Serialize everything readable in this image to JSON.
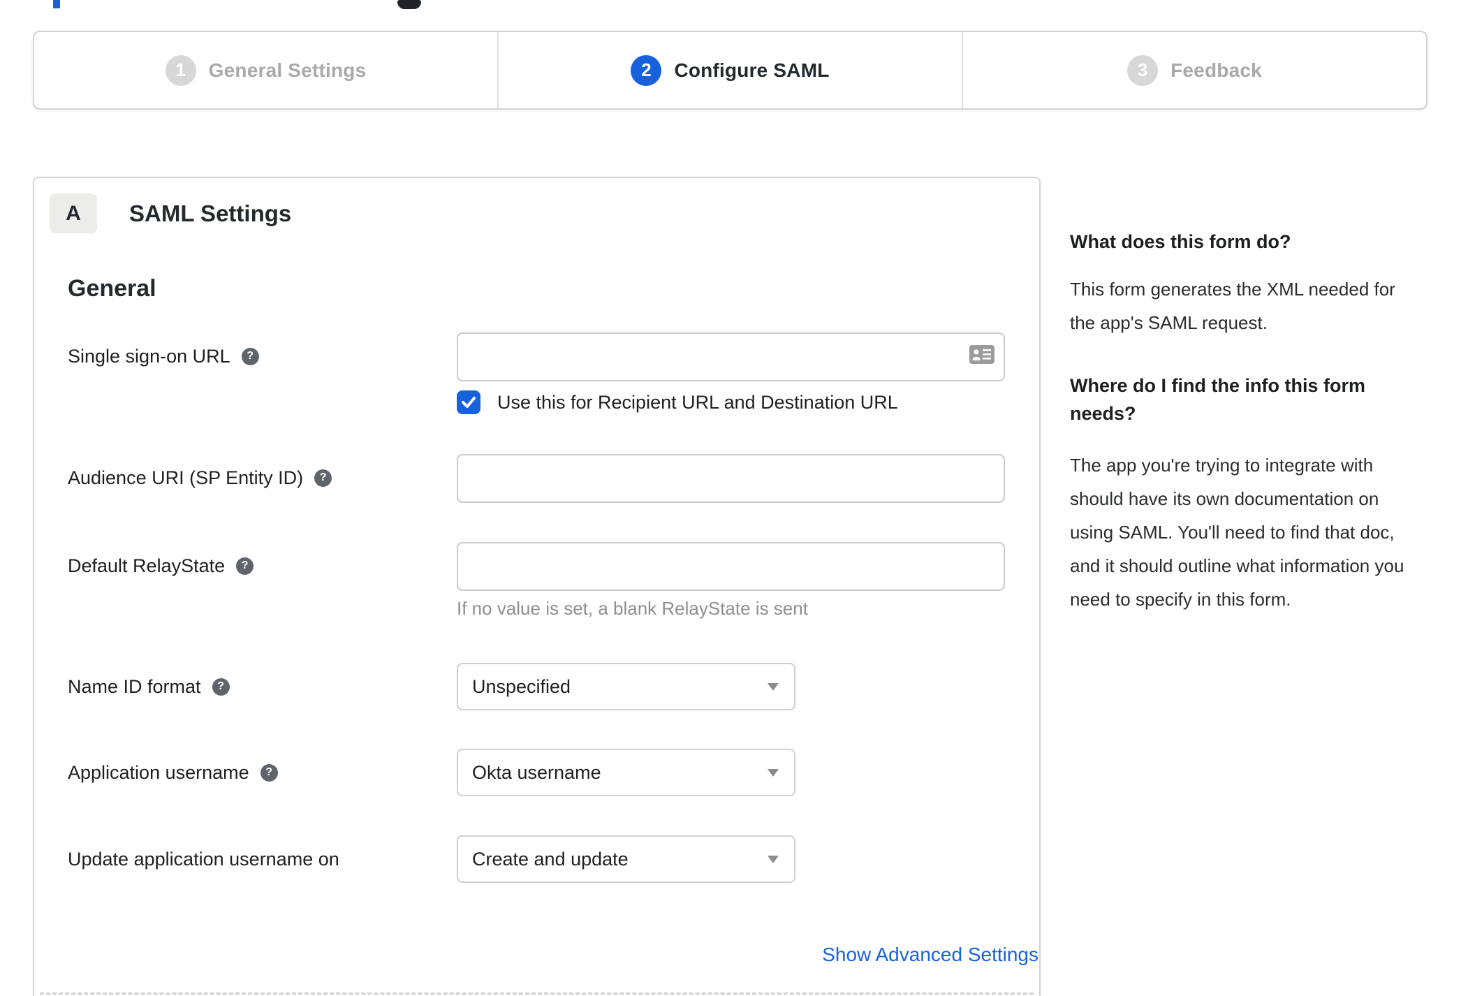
{
  "stepper": {
    "active_step": "2",
    "steps": [
      {
        "number": "1",
        "label": "General Settings"
      },
      {
        "number": "2",
        "label": "Configure SAML"
      },
      {
        "number": "3",
        "label": "Feedback"
      }
    ]
  },
  "panel": {
    "badge": "A",
    "title": "SAML Settings",
    "section": "General",
    "fields": {
      "sso_url": {
        "label": "Single sign-on URL",
        "value": "",
        "checkbox_checked": true,
        "checkbox_label": "Use this for Recipient URL and Destination URL"
      },
      "audience_uri": {
        "label": "Audience URI (SP Entity ID)",
        "value": ""
      },
      "relay_state": {
        "label": "Default RelayState",
        "value": "",
        "hint": "If no value is set, a blank RelayState is sent"
      },
      "name_id": {
        "label": "Name ID format",
        "value": "Unspecified"
      },
      "app_username": {
        "label": "Application username",
        "value": "Okta username"
      },
      "update_username": {
        "label": "Update application username on",
        "value": "Create and update"
      }
    },
    "advanced_link": "Show Advanced Settings"
  },
  "sidebar": {
    "blocks": [
      {
        "heading": "What does this form do?",
        "body": "This form generates the XML needed for the app's SAML request."
      },
      {
        "heading": "Where do I find the info this form needs?",
        "body": "The app you're trying to integrate with should have its own documentation on using SAML. You'll need to find that doc, and it should outline what information you need to specify in this form."
      }
    ]
  },
  "icons": {
    "help": "?"
  },
  "colors": {
    "accent_blue": "#1662dd",
    "inactive_grey": "#a7a9ac",
    "border_grey": "#d4d4d4",
    "hint_grey": "#8d8f91",
    "help_icon_bg": "#5e6469"
  }
}
